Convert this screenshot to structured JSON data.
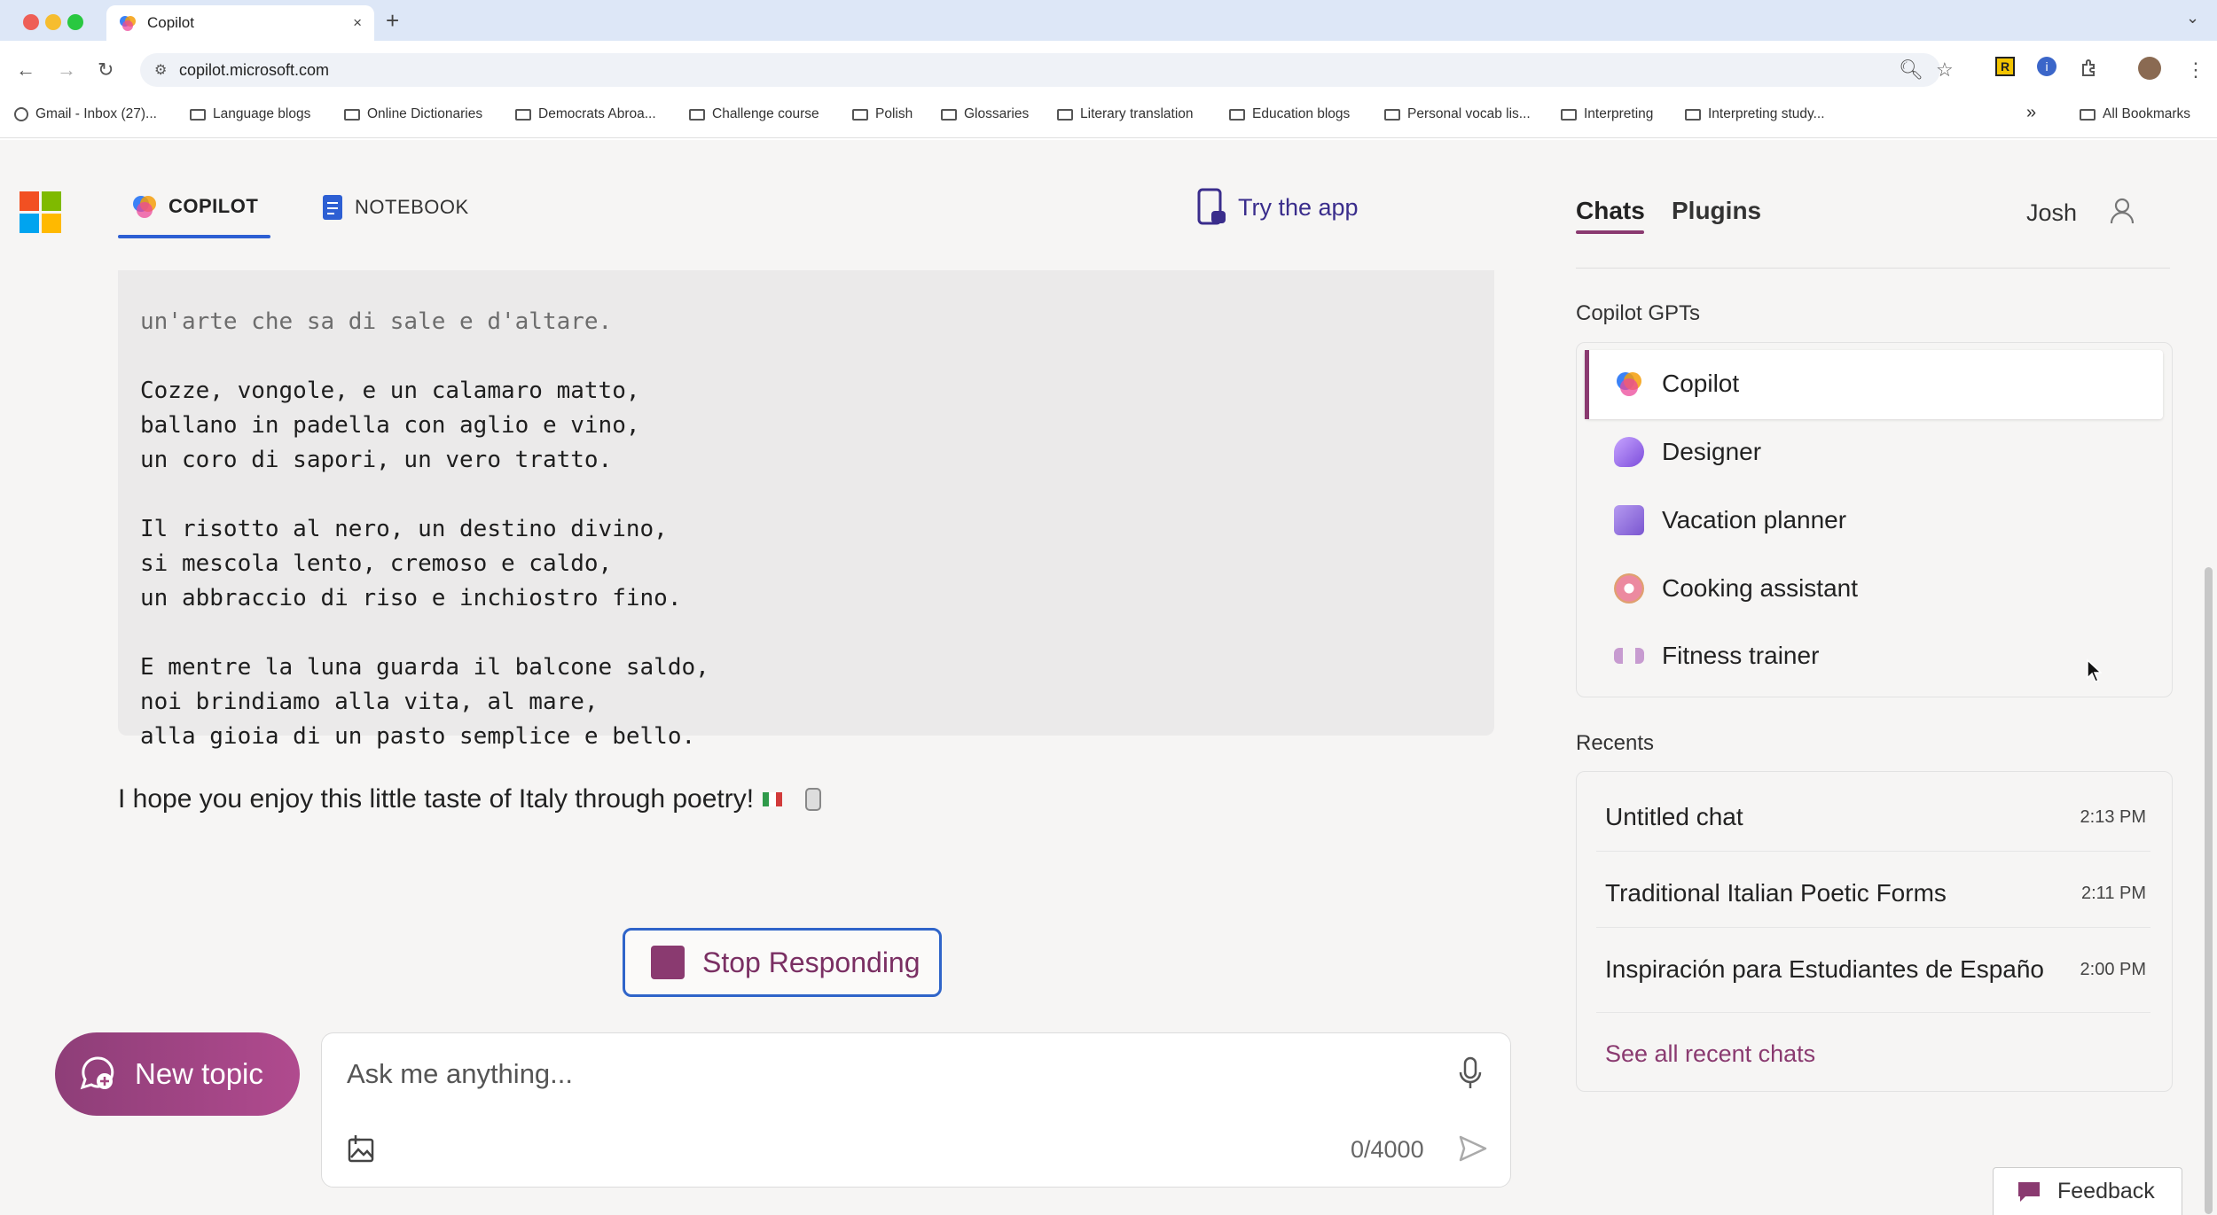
{
  "browser": {
    "tab_title": "Copilot",
    "tab_close": "×",
    "new_tab": "+",
    "url": "copilot.microsoft.com",
    "bookmarks": [
      "Gmail - Inbox (27)...",
      "Language blogs",
      "Online Dictionaries",
      "Democrats Abroa...",
      "Challenge course",
      "Polish",
      "Glossaries",
      "Literary translation",
      "Education blogs",
      "Personal vocab lis...",
      "Interpreting",
      "Interpreting study..."
    ],
    "more_bookmarks": "»",
    "all_bookmarks": "All Bookmarks"
  },
  "header": {
    "copilot_tab": "COPILOT",
    "notebook_tab": "NOTEBOOK",
    "try_app": "Try the app"
  },
  "conversation": {
    "poem_lines": [
      "un'arte che sa di sale e d'altare.",
      "",
      "Cozze, vongole, e un calamaro matto,",
      "ballano in padella con aglio e vino,",
      "un coro di sapori, un vero tratto.",
      "",
      "Il risotto al nero, un destino divino,",
      "si mescola lento, cremoso e caldo,",
      "un abbraccio di riso e inchiostro fino.",
      "",
      "E mentre la luna guarda il balcone saldo,",
      "noi brindiamo alla vita, al mare,",
      "alla gioia di un pasto semplice e bello."
    ],
    "closing_message": "I hope you enjoy this little taste of Italy through poetry!",
    "stop_button": "Stop Responding"
  },
  "composer": {
    "new_topic": "New topic",
    "placeholder": "Ask me anything...",
    "char_count": "0/4000"
  },
  "sidebar": {
    "tabs": [
      "Chats",
      "Plugins"
    ],
    "user_name": "Josh",
    "gpts_label": "Copilot GPTs",
    "gpts": [
      {
        "name": "Copilot",
        "color": "#4f8ff7"
      },
      {
        "name": "Designer",
        "color": "#9b6ee0"
      },
      {
        "name": "Vacation planner",
        "color": "#8d6bd6"
      },
      {
        "name": "Cooking assistant",
        "color": "#e47a8c"
      },
      {
        "name": "Fitness trainer",
        "color": "#b77ab8"
      }
    ],
    "recents_label": "Recents",
    "recents": [
      {
        "title": "Untitled chat",
        "time": "2:13 PM"
      },
      {
        "title": "Traditional Italian Poetic Forms",
        "time": "2:11 PM"
      },
      {
        "title": "Inspiración para Estudiantes de Español",
        "time": "2:00 PM"
      }
    ],
    "see_all": "See all recent chats"
  },
  "feedback": "Feedback",
  "colors": {
    "accent": "#8a3a70",
    "focus_blue": "#2f64c9",
    "notebook_blue": "#2d5fd3"
  }
}
